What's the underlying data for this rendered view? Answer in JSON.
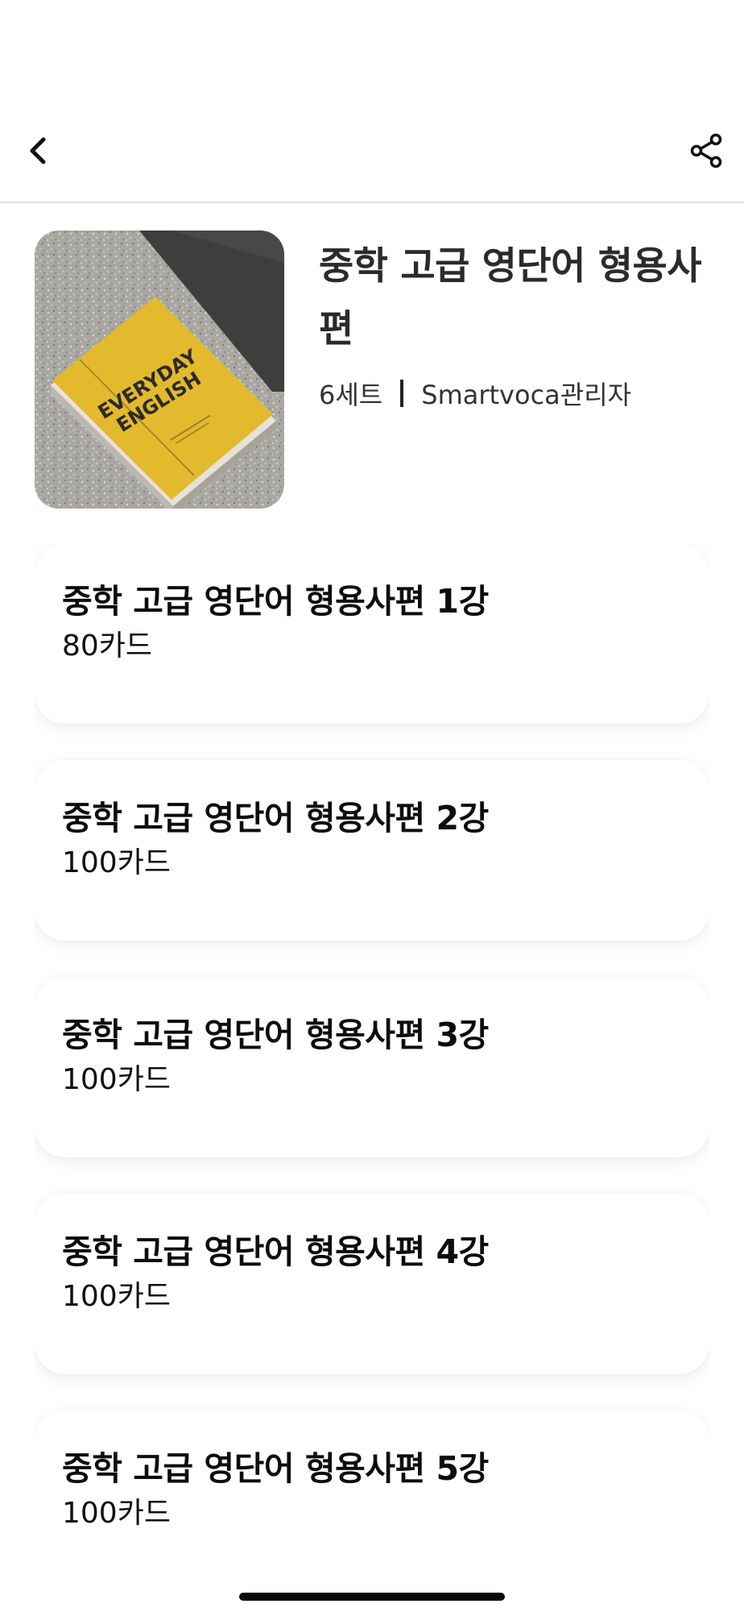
{
  "header": {
    "back_icon": "chevron-left-icon",
    "share_icon": "share-icon"
  },
  "summary": {
    "title": "중학 고급 영단어 형용사편",
    "set_count": "6세트",
    "author": "Smartvoca관리자",
    "cover_book_text": [
      "EVERYDAY",
      "ENGLISH"
    ]
  },
  "decks": [
    {
      "title": "중학 고급 영단어 형용사편 1강",
      "count": "80카드"
    },
    {
      "title": "중학 고급 영단어 형용사편 2강",
      "count": "100카드"
    },
    {
      "title": "중학 고급 영단어 형용사편 3강",
      "count": "100카드"
    },
    {
      "title": "중학 고급 영단어 형용사편 4강",
      "count": "100카드"
    },
    {
      "title": "중학 고급 영단어 형용사편 5강",
      "count": "100카드"
    }
  ],
  "colors": {
    "background": "#ffffff",
    "text_primary": "#111111",
    "divider": "#e3e3e3",
    "book_cover": "#e3b92d"
  }
}
